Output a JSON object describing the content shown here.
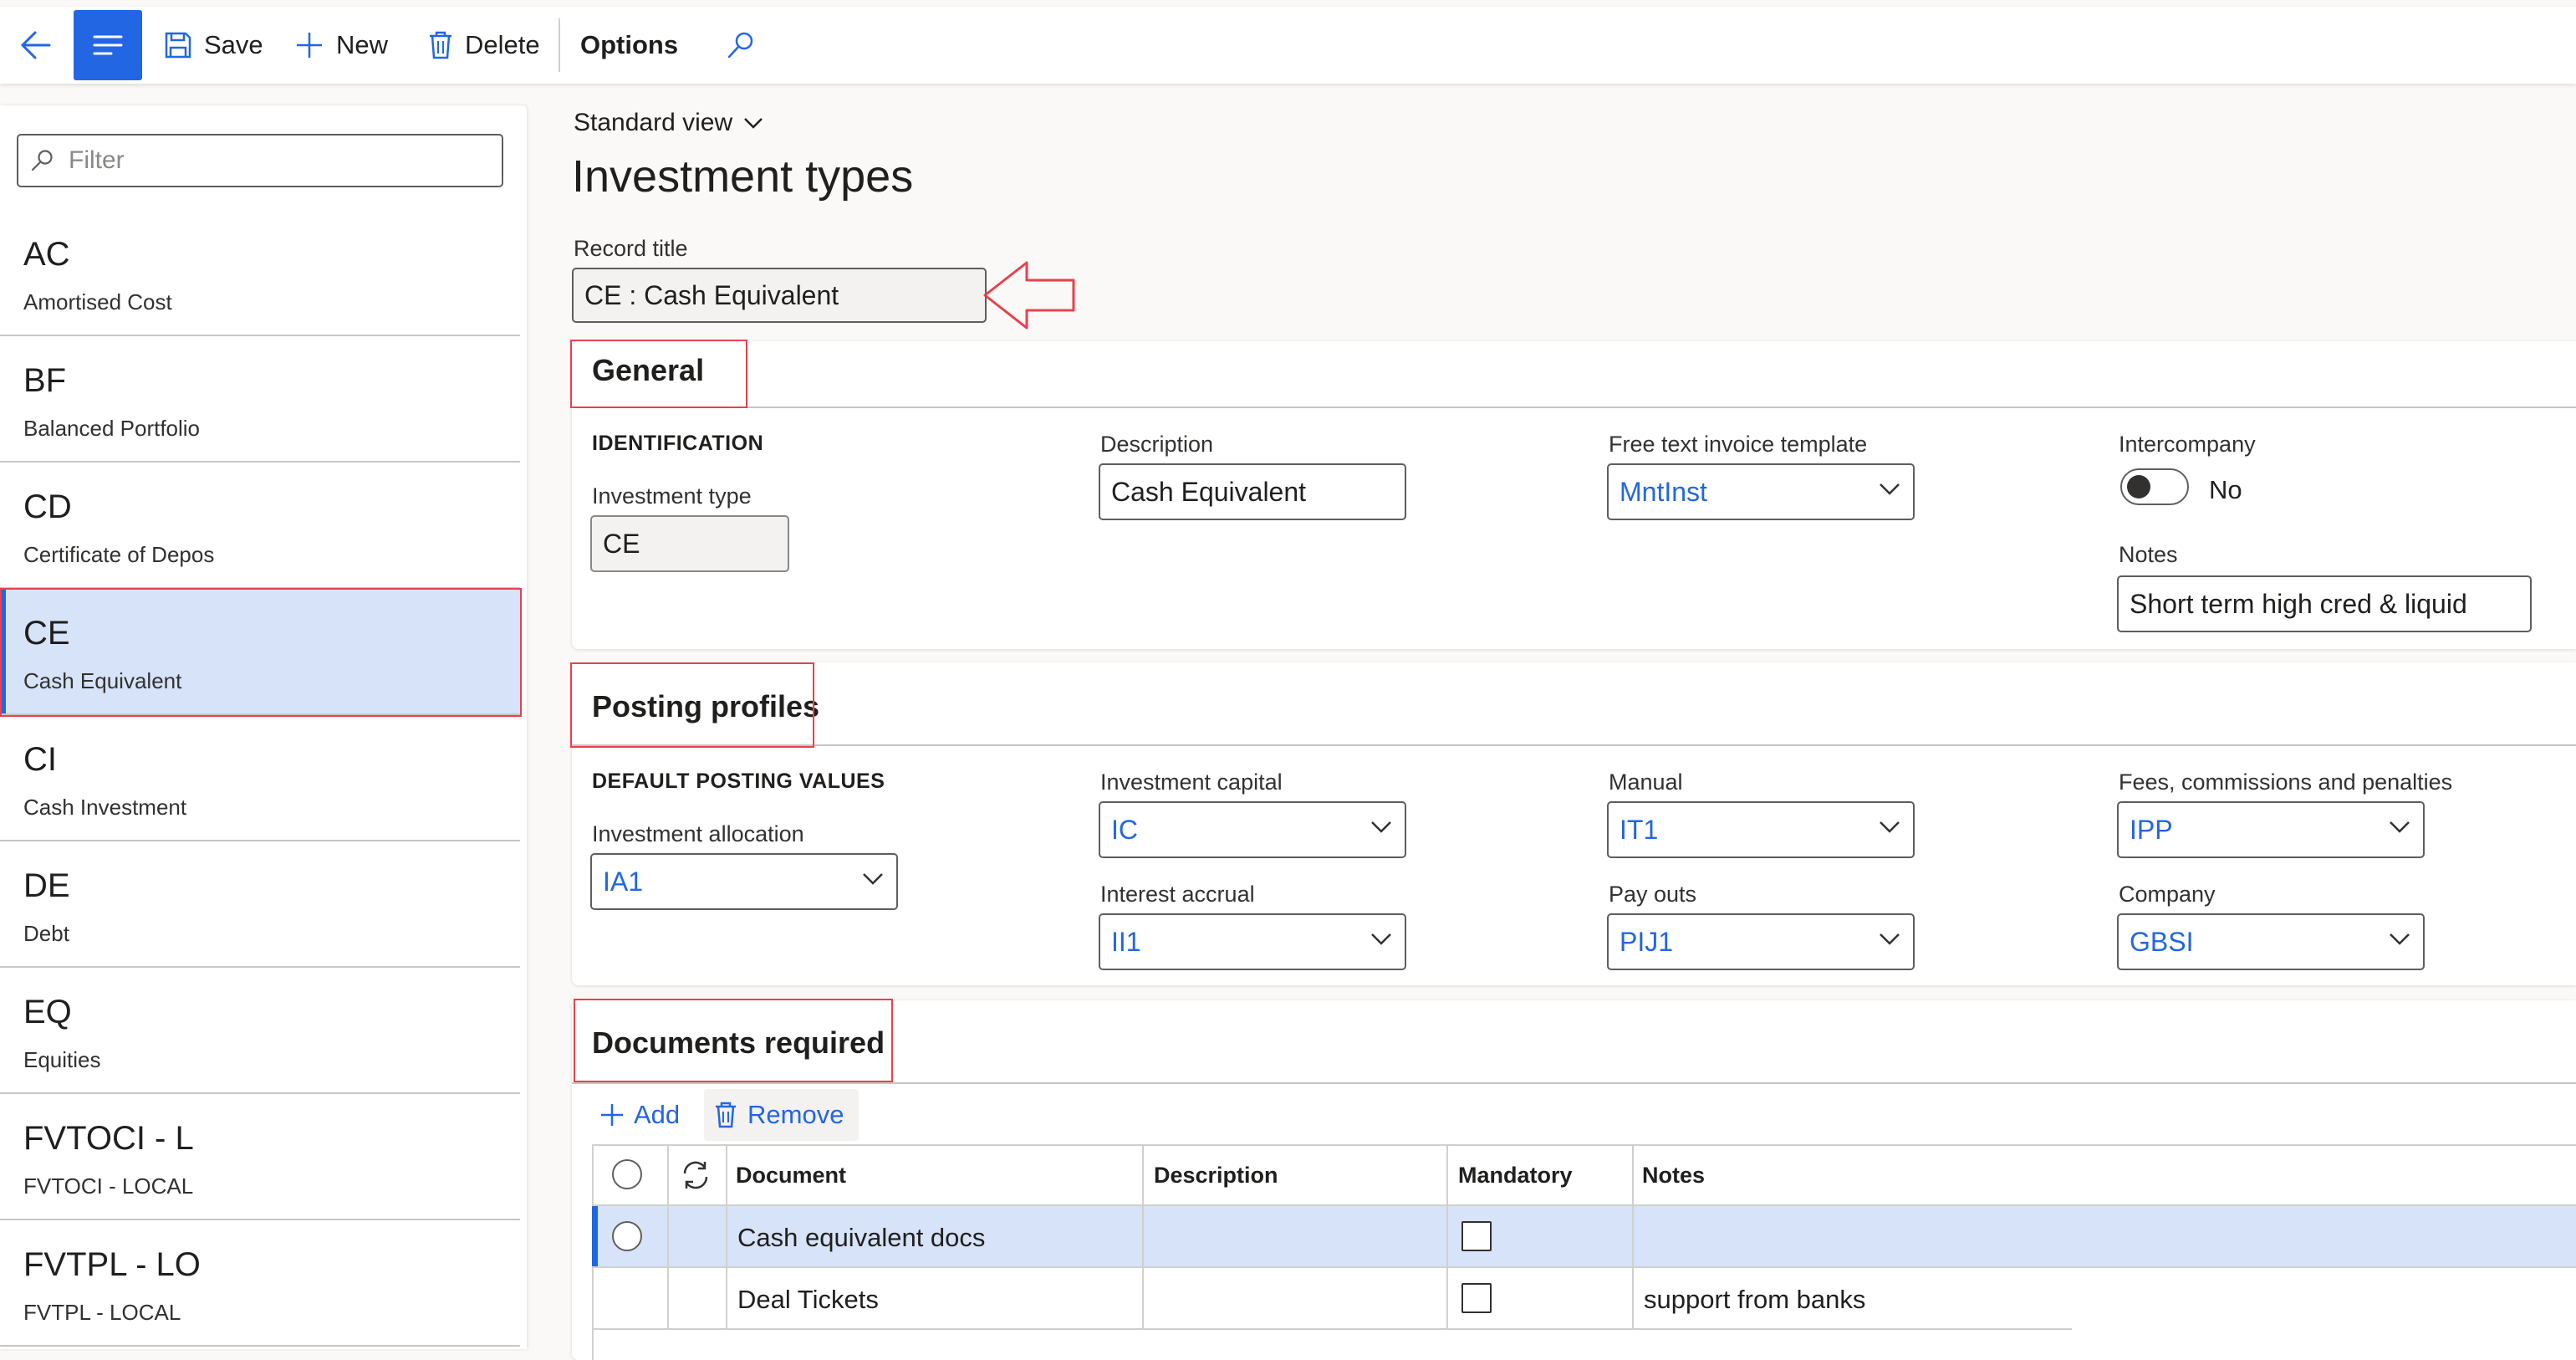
{
  "toolbar": {
    "save_label": "Save",
    "new_label": "New",
    "delete_label": "Delete",
    "options_label": "Options"
  },
  "left_pane": {
    "filter_placeholder": "Filter",
    "items": [
      {
        "code": "AC",
        "desc": "Amortised Cost"
      },
      {
        "code": "BF",
        "desc": "Balanced Portfolio"
      },
      {
        "code": "CD",
        "desc": "Certificate of Depos"
      },
      {
        "code": "CE",
        "desc": "Cash Equivalent",
        "selected": true
      },
      {
        "code": "CI",
        "desc": "Cash Investment"
      },
      {
        "code": "DE",
        "desc": "Debt"
      },
      {
        "code": "EQ",
        "desc": "Equities"
      },
      {
        "code": "FVTOCI - L",
        "desc": "FVTOCI - LOCAL"
      },
      {
        "code": "FVTPL - LO",
        "desc": "FVTPL - LOCAL"
      }
    ]
  },
  "page": {
    "view_name": "Standard view",
    "title": "Investment types",
    "record_title_label": "Record title",
    "record_title_value": "CE : Cash Equivalent"
  },
  "general": {
    "title": "General",
    "identification_label": "IDENTIFICATION",
    "investment_type_label": "Investment type",
    "investment_type_value": "CE",
    "description_label": "Description",
    "description_value": "Cash Equivalent",
    "free_text_label": "Free text invoice template",
    "free_text_value": "MntInst",
    "intercompany_label": "Intercompany",
    "intercompany_value": "No",
    "notes_label": "Notes",
    "notes_value": "Short term high cred & liquid"
  },
  "posting": {
    "title": "Posting profiles",
    "group_label": "DEFAULT POSTING VALUES",
    "investment_allocation_label": "Investment allocation",
    "investment_allocation_value": "IA1",
    "investment_capital_label": "Investment capital",
    "investment_capital_value": "IC",
    "interest_accrual_label": "Interest accrual",
    "interest_accrual_value": "II1",
    "manual_label": "Manual",
    "manual_value": "IT1",
    "pay_outs_label": "Pay outs",
    "pay_outs_value": "PIJ1",
    "fees_label": "Fees, commissions and penalties",
    "fees_value": "IPP",
    "company_label": "Company",
    "company_value": "GBSI"
  },
  "documents": {
    "title": "Documents required",
    "add_label": "Add",
    "remove_label": "Remove",
    "columns": {
      "document": "Document",
      "description": "Description",
      "mandatory": "Mandatory",
      "notes": "Notes"
    },
    "rows": [
      {
        "document": "Cash equivalent docs",
        "description": "",
        "mandatory": false,
        "notes": "",
        "selected": true
      },
      {
        "document": "Deal Tickets",
        "description": "",
        "mandatory": false,
        "notes": "support from banks"
      }
    ]
  },
  "colors": {
    "accent": "#2266e3",
    "selection": "#d6e3f8",
    "annotation": "#e8414e"
  }
}
